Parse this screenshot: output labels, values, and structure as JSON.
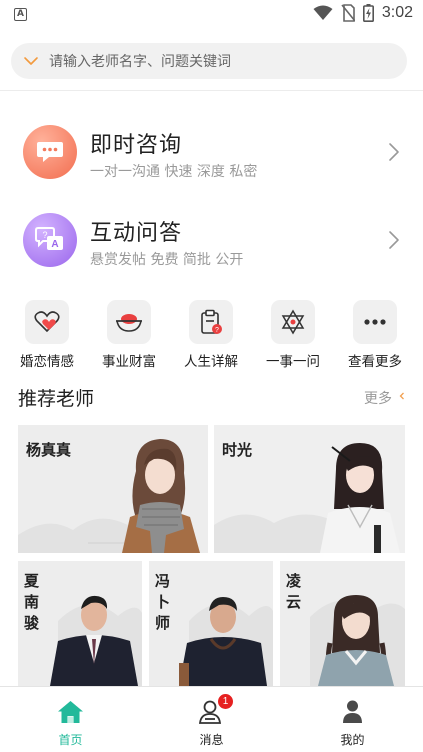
{
  "status_bar": {
    "time": "3:02",
    "notif_letter": "A"
  },
  "search": {
    "placeholder": "请输入老师名字、问题关键词"
  },
  "services": [
    {
      "title": "即时咨询",
      "subtitle": "一对一沟通  快速 深度 私密",
      "icon": "chat-bubble-icon",
      "color": "#f7856a"
    },
    {
      "title": "互动问答",
      "subtitle": "悬赏发帖  免费 简批 公开",
      "icon": "qa-icon",
      "color": "#a97cf0"
    }
  ],
  "categories": [
    {
      "label": "婚恋情感",
      "icon": "heart-icon"
    },
    {
      "label": "事业财富",
      "icon": "treasure-bowl-icon"
    },
    {
      "label": "人生详解",
      "icon": "clipboard-icon"
    },
    {
      "label": "一事一问",
      "icon": "star-of-david-icon"
    },
    {
      "label": "查看更多",
      "icon": "more-dots-icon"
    }
  ],
  "recommend": {
    "title": "推荐老师",
    "more": "更多"
  },
  "teachers": [
    {
      "name": "杨真真"
    },
    {
      "name": "时光"
    },
    {
      "name": "夏南骏"
    },
    {
      "name": "冯卜师"
    },
    {
      "name": "凌云"
    }
  ],
  "tabs": [
    {
      "label": "首页",
      "icon": "home-icon",
      "active": true
    },
    {
      "label": "消息",
      "icon": "message-icon",
      "badge": "1"
    },
    {
      "label": "我的",
      "icon": "profile-icon"
    }
  ],
  "colors": {
    "accent": "#22b99a",
    "badge": "#e62020"
  }
}
